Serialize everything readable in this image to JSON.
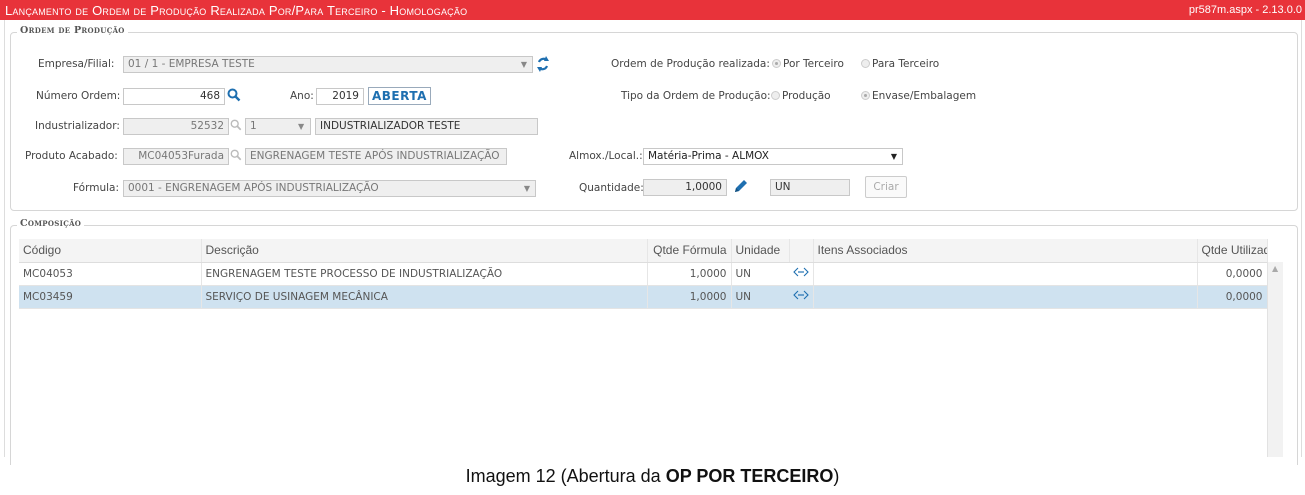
{
  "app": {
    "title": "Lançamento de Ordem de Produção Realizada Por/Para Terceiro  - Homologação",
    "version": "pr587m.aspx - 2.13.0.0"
  },
  "ordem_producao": {
    "legend": "Ordem de Produção",
    "empresa": {
      "label": "Empresa/Filial:",
      "value": "01 / 1 - EMPRESA TESTE"
    },
    "numero": {
      "label": "Número Ordem:",
      "value": "468"
    },
    "ano": {
      "label": "Ano:",
      "value": "2019"
    },
    "status": "ABERTA",
    "industrializador": {
      "label": "Industrializador:",
      "code": "52532",
      "seq": "1",
      "name": "INDUSTRIALIZADOR TESTE"
    },
    "produto": {
      "label": "Produto Acabado:",
      "code": "MC04053Furada",
      "desc": "ENGRENAGEM TESTE APÓS INDUSTRIALIZAÇÃO"
    },
    "formula": {
      "label": "Fórmula:",
      "value": "0001 - ENGRENAGEM APÓS INDUSTRIALIZAÇÃO"
    },
    "realizada": {
      "label": "Ordem de Produção realizada:",
      "options": [
        "Por Terceiro",
        "Para Terceiro"
      ],
      "selected": "Por Terceiro"
    },
    "tipo": {
      "label": "Tipo da Ordem de Produção:",
      "options": [
        "Produção",
        "Envase/Embalagem"
      ],
      "selected": "Envase/Embalagem"
    },
    "almox": {
      "label": "Almox./Local.:",
      "value": "Matéria-Prima - ALMOX"
    },
    "quantidade": {
      "label": "Quantidade:",
      "value": "1,0000",
      "unit": "UN"
    },
    "criar_label": "Criar"
  },
  "composicao": {
    "legend": "Composição",
    "columns": [
      "Código",
      "Descrição",
      "Qtde Fórmula",
      "Unidade",
      "Itens Associados",
      "Qtde Utilizada"
    ],
    "rows": [
      {
        "codigo": "MC04053",
        "descricao": "ENGRENAGEM TESTE PROCESSO DE INDUSTRIALIZAÇÃO",
        "qtde_formula": "1,0000",
        "unidade": "UN",
        "itens": "",
        "qtde_utilizada": "0,0000"
      },
      {
        "codigo": "MC03459",
        "descricao": "SERVIÇO DE USINAGEM MECÂNICA",
        "qtde_formula": "1,0000",
        "unidade": "UN",
        "itens": "",
        "qtde_utilizada": "0,0000"
      }
    ],
    "selected_row": 1
  },
  "caption": {
    "prefix": "Imagem 12 (Abertura da ",
    "bold": "OP POR TERCEIRO",
    "suffix": ")"
  },
  "colors": {
    "titlebar": "#e8333a",
    "accent": "#1e6fb0",
    "selected_row": "#cfe2f0"
  },
  "icons": [
    "refresh-icon",
    "search-icon",
    "edit-pencil-icon",
    "associate-link-icon",
    "chevron-down-icon"
  ]
}
